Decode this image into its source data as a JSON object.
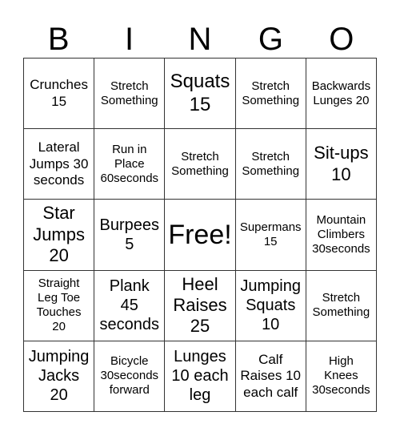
{
  "header": [
    "B",
    "I",
    "N",
    "G",
    "O"
  ],
  "cells": [
    "Crunches\n15",
    "Stretch\nSomething",
    "Squats\n15",
    "Stretch\nSomething",
    "Backwards\nLunges 20",
    "Lateral\nJumps 30\nseconds",
    "Run in\nPlace\n60seconds",
    "Stretch\nSomething",
    "Stretch\nSomething",
    "Sit-ups\n10",
    "Star\nJumps\n20",
    "Burpees\n5",
    "Free!",
    "Supermans\n15",
    "Mountain\nClimbers\n30seconds",
    "Straight\nLeg Toe\nTouches\n20",
    "Plank\n45\nseconds",
    "Heel\nRaises\n25",
    "Jumping\nSquats\n10",
    "Stretch\nSomething",
    "Jumping\nJacks\n20",
    "Bicycle\n30seconds\nforward",
    "Lunges\n10 each\nleg",
    "Calf\nRaises 10\neach calf",
    "High\nKnees\n30seconds"
  ]
}
